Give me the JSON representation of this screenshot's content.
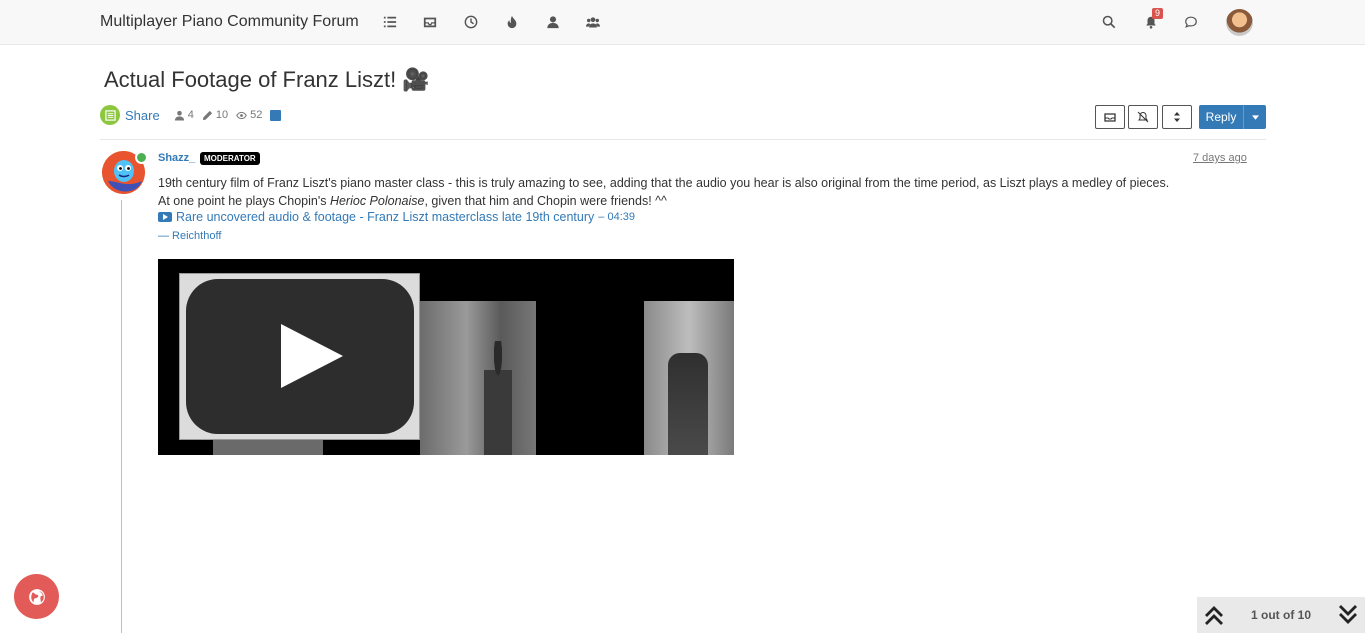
{
  "navbar": {
    "brand": "Multiplayer Piano Community Forum",
    "nav_icons": [
      "list-icon",
      "inbox-icon",
      "clock-icon",
      "fire-icon",
      "user-icon",
      "users-icon"
    ],
    "notification_count": "9"
  },
  "topic": {
    "title": "Actual Footage of Franz Liszt! 🎥",
    "share_label": "Share",
    "posters": "4",
    "posts": "10",
    "views": "52"
  },
  "toolbar": {
    "reply_label": "Reply"
  },
  "post": {
    "username": "Shazz_",
    "role_badge": "MODERATOR",
    "timestamp": "7 days ago",
    "body_line1": "19th century film of Franz Liszt's piano master class - this is truly amazing to see, adding that the audio you hear is also original from the time period, as Liszt plays a medley of pieces.",
    "body_line2_before": "At one point he plays Chopin's ",
    "body_line2_em": "Herioc Polonaise",
    "body_line2_after": ", given that him and Chopin were friends! ^^",
    "video_link_title": "Rare uncovered audio & footage - Franz Liszt masterclass late 19th century",
    "video_duration": "– 04:39",
    "video_author": "— Reichthoff"
  },
  "pagination": {
    "label": "1 out of 10"
  },
  "colors": {
    "accent": "#337ab7",
    "fab": "#e25b58",
    "share": "#8dc63f"
  }
}
